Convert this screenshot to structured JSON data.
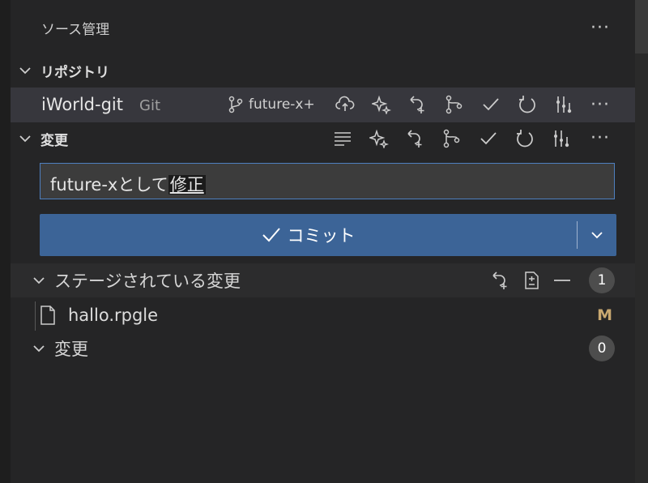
{
  "header": {
    "title": "ソース管理",
    "more_label": "···"
  },
  "repositories": {
    "label": "リポジトリ",
    "repo": {
      "name": "iWorld-git",
      "provider": "Git",
      "branch": "future-x+",
      "more_label": "···"
    }
  },
  "changes": {
    "label": "変更",
    "more_label": "···",
    "message_input": {
      "value_prefix": "future-xとして",
      "value_selected": "修正"
    },
    "commit": {
      "label": "コミット"
    },
    "staged_group": {
      "label": "ステージされている変更",
      "count": "1",
      "files": [
        {
          "name": "hallo.rpgle",
          "status": "M"
        }
      ]
    },
    "changes_group": {
      "label": "変更",
      "count": "0"
    }
  },
  "colors": {
    "accent": "#3c6497",
    "input_border": "#4e7fbf",
    "modified": "#c8a870",
    "background": "#252526"
  },
  "icons": [
    "chevron-down-icon",
    "branch-icon",
    "cloud-upload-icon",
    "sparkle-icon",
    "undo-icon",
    "merge-icon",
    "check-icon",
    "refresh-icon",
    "graph-icon",
    "list-icon",
    "ellipsis-icon",
    "file-icon",
    "open-file-icon",
    "discard-icon",
    "unstage-icon"
  ]
}
